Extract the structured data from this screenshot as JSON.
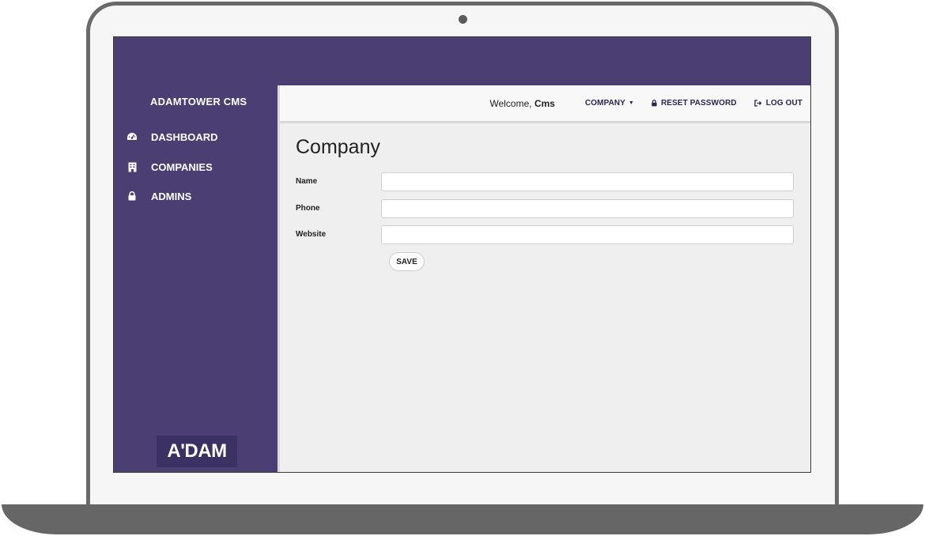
{
  "app": {
    "brand": "ADAMTOWER CMS",
    "logo_text": "A'DAM"
  },
  "sidebar": {
    "items": [
      {
        "label": "DASHBOARD",
        "icon": "dashboard-icon"
      },
      {
        "label": "COMPANIES",
        "icon": "building-icon"
      },
      {
        "label": "ADMINS",
        "icon": "lock-icon"
      }
    ]
  },
  "header": {
    "welcome_prefix": "Welcome,",
    "username": "Cms",
    "company_menu": "COMPANY",
    "reset_password": "RESET PASSWORD",
    "logout": "LOG OUT"
  },
  "main": {
    "title": "Company",
    "fields": {
      "name": {
        "label": "Name",
        "value": ""
      },
      "phone": {
        "label": "Phone",
        "value": ""
      },
      "website": {
        "label": "Website",
        "value": ""
      }
    },
    "save_label": "SAVE"
  },
  "colors": {
    "sidebar_bg": "#4a3e73",
    "content_bg": "#efefef",
    "accent_text": "#2b2550"
  }
}
